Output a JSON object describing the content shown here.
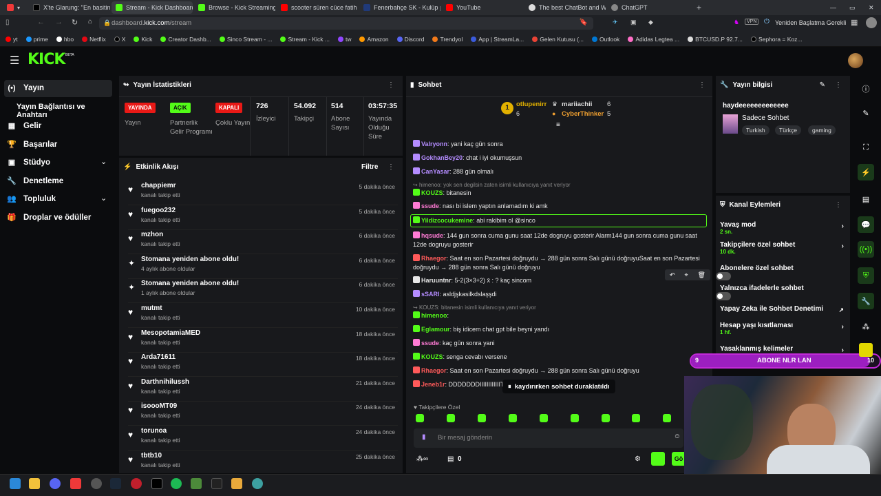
{
  "browser": {
    "tabs": [
      "X'te Glarung: \"En basitinde",
      "Stream - Kick Dashboard",
      "Browse - Kick Streaming",
      "scooter süren cüce fatih ter",
      "Fenerbahçe SK - Kulüp pro",
      "YouTube",
      "The best ChatBot and Widg",
      "ChatGPT"
    ],
    "url_prefix": "dashboard.",
    "url_host": "kick.com",
    "url_path": "/stream",
    "restart_label": "Yeniden Başlatma Gerekli",
    "vpn": "VPN",
    "bookmarks": [
      "yt",
      "prime",
      "hbo",
      "Netflix",
      "X",
      "Kick",
      "Creator Dashb...",
      "Sinco Stream - ...",
      "Stream - Kick ...",
      "tw",
      "Amazon",
      "Discord",
      "Trendyol",
      "App | StreamLa...",
      "Gelen Kutusu (...",
      "Outlook",
      "Adidas Legtea ...",
      "BTCUSD.P 92.7...",
      "Sephora = Koz..."
    ]
  },
  "header": {
    "logo": "KICK",
    "beta": "BETA"
  },
  "sidebar": [
    {
      "label": "Yayın",
      "icon": "(•)"
    },
    {
      "label": "Yayın Bağlantısı ve Anahtarı",
      "icon": ""
    },
    {
      "label": "Gelir",
      "icon": "▦"
    },
    {
      "label": "Başarılar",
      "icon": "🏆"
    },
    {
      "label": "Stüdyo",
      "icon": "▣"
    },
    {
      "label": "Denetleme",
      "icon": "🔧"
    },
    {
      "label": "Topluluk",
      "icon": "👥"
    },
    {
      "label": "Droplar ve ödüller",
      "icon": "🎁"
    }
  ],
  "stats": {
    "title": "Yayın İstatistikleri",
    "yayin_badge": "YAYINDA",
    "yayin_label": "Yayın",
    "partner_badge": "AÇIK",
    "partner_label": "Partnerlik Gelir Programı",
    "multi_badge": "KAPALI",
    "multi_label": "Çoklu Yayın",
    "viewers": "726",
    "viewers_label": "İzleyici",
    "followers": "54.092",
    "followers_label": "Takipçi",
    "subs": "514",
    "subs_label": "Abone Sayısı",
    "uptime": "03:57:35",
    "uptime_label": "Yayında Olduğu Süre"
  },
  "activity": {
    "title": "Etkinlik Akışı",
    "filter": "Filtre",
    "events": [
      {
        "icon": "♥",
        "name": "chappiemr",
        "sub": "kanalı takip etti",
        "time": "5 dakika önce"
      },
      {
        "icon": "♥",
        "name": "fuegoo232",
        "sub": "kanalı takip etti",
        "time": "5 dakika önce"
      },
      {
        "icon": "♥",
        "name": "mzhon",
        "sub": "kanalı takip etti",
        "time": "6 dakika önce"
      },
      {
        "icon": "✦",
        "name": "Stomana yeniden abone oldu!",
        "sub": "4 aylık abone oldular",
        "time": "6 dakika önce"
      },
      {
        "icon": "✦",
        "name": "Stomana yeniden abone oldu!",
        "sub": "1 aylık abone oldular",
        "time": "6 dakika önce"
      },
      {
        "icon": "♥",
        "name": "mutmt",
        "sub": "kanalı takip etti",
        "time": "10 dakika önce"
      },
      {
        "icon": "♥",
        "name": "MesopotamiaMED",
        "sub": "kanalı takip etti",
        "time": "18 dakika önce"
      },
      {
        "icon": "♥",
        "name": "Arda71611",
        "sub": "kanalı takip etti",
        "time": "18 dakika önce"
      },
      {
        "icon": "♥",
        "name": "Darthnihilussh",
        "sub": "kanalı takip etti",
        "time": "21 dakika önce"
      },
      {
        "icon": "♥",
        "name": "isoooMT09",
        "sub": "kanalı takip etti",
        "time": "24 dakika önce"
      },
      {
        "icon": "♥",
        "name": "torunoa",
        "sub": "kanalı takip etti",
        "time": "24 dakika önce"
      },
      {
        "icon": "♥",
        "name": "tbtb10",
        "sub": "kanalı takip etti",
        "time": "25 dakika önce"
      }
    ]
  },
  "chat": {
    "title": "Sohbet",
    "top": [
      {
        "name": "otlupenirr",
        "count": "6",
        "rank": "1"
      },
      {
        "name": "mariiachii",
        "count": "6"
      },
      {
        "name": "CyberThinker",
        "count": "5"
      }
    ],
    "messages": [
      {
        "user": "Valryonn",
        "color": "#b48cff",
        "text": "yani kaç gün sonra"
      },
      {
        "user": "GokhanBey20",
        "color": "#b48cff",
        "text": "chat i iyi okumuşsun"
      },
      {
        "user": "CanYasar",
        "color": "#b48cff",
        "text": "288 gün olmalı"
      },
      {
        "reply": "himenoo: yok sen degilsin zaten isimli kullanıcıya yanıt veriyor"
      },
      {
        "user": "KOUZS",
        "color": "#53fc18",
        "text": "bitanesin"
      },
      {
        "user": "ssude",
        "color": "#ff7bd5",
        "text": "nası bi islem yaptın anlamadım ki amk"
      },
      {
        "user": "Yildizcocukemine",
        "color": "#53fc18",
        "text": "abi rakibim ol @sinco"
      },
      {
        "user": "hqsude",
        "color": "#ff7bd5",
        "text": "144 gun sonra cuma gunu saat 12de dogruyu gosterir Alarm144 gun sonra cuma gunu saat 12de dogruyu gosterir"
      },
      {
        "user": "Rhaegor",
        "color": "#ff5a5a",
        "text": "Saat en son Pazartesi doğruydu → 288 gün sonra Salı günü doğruyuSaat en son Pazartesi doğruydu → 288 gün sonra Salı günü doğruyu"
      },
      {
        "user": "Haruuntnr",
        "color": "#e8e8e8",
        "text": "5-2(3×3+2) x̄ : ? kaç sincom"
      },
      {
        "user": "sSARI",
        "color": "#b48cff",
        "text": "asldjşkasilkdslaşşdi"
      },
      {
        "reply": "KOUZS: bitanesin isimli kullanıcıya yanıt veriyor"
      },
      {
        "user": "himenoo",
        "color": "#53fc18",
        "text": ""
      },
      {
        "user": "Eglamour",
        "color": "#53fc18",
        "text": "biş idicem chat gpt bile beyni yandı"
      },
      {
        "user": "ssude",
        "color": "#ff7bd5",
        "text": "kaç gün sonra yani"
      },
      {
        "user": "KOUZS",
        "color": "#53fc18",
        "text": "senga cevabı versene"
      },
      {
        "user": "Rhaegor",
        "color": "#ff5a5a",
        "text": "Saat en son Pazartesi doğruydu → 288 gün sonra Salı günü doğruyu"
      },
      {
        "user": "Jeneb1r",
        "color": "#ff5a5a",
        "text": "DDDDDDDIIIIIIIIIIIITTTT"
      }
    ],
    "paused": "kaydırırken sohbet duraklatıldı",
    "followers_only": "Takipçilere Özel",
    "placeholder": "Bir mesaj gönderin",
    "points": "0",
    "send": "Gö"
  },
  "info": {
    "title": "Yayın bilgisi",
    "stream_title": "haydeeeeeeeeeeeee",
    "category": "Sadece Sohbet",
    "tags": [
      "Turkish",
      "Türkçe",
      "gaming"
    ]
  },
  "channel": {
    "title": "Kanal Eylemleri",
    "items": [
      {
        "label": "Yavaş mod",
        "sub": "2 sn."
      },
      {
        "label": "Takipçilere özel sohbet",
        "sub": "10 dk."
      },
      {
        "label": "Abonelere özel sohbet",
        "sub": ""
      },
      {
        "label": "Yalnızca ifadelerle sohbet",
        "sub": ""
      },
      {
        "label": "Yapay Zeka ile Sohbet Denetimi",
        "sub": ""
      },
      {
        "label": "Hesap yaşı kısıtlaması",
        "sub": "1 hf."
      },
      {
        "label": "Yasaklanmış kelimeler",
        "sub": ""
      }
    ]
  },
  "poll": {
    "left": "9",
    "label": "ABONE NLR LAN",
    "right": "10"
  },
  "colors": {
    "kick": "#53fc18",
    "live": "#e91916",
    "panel": "#18191c"
  }
}
